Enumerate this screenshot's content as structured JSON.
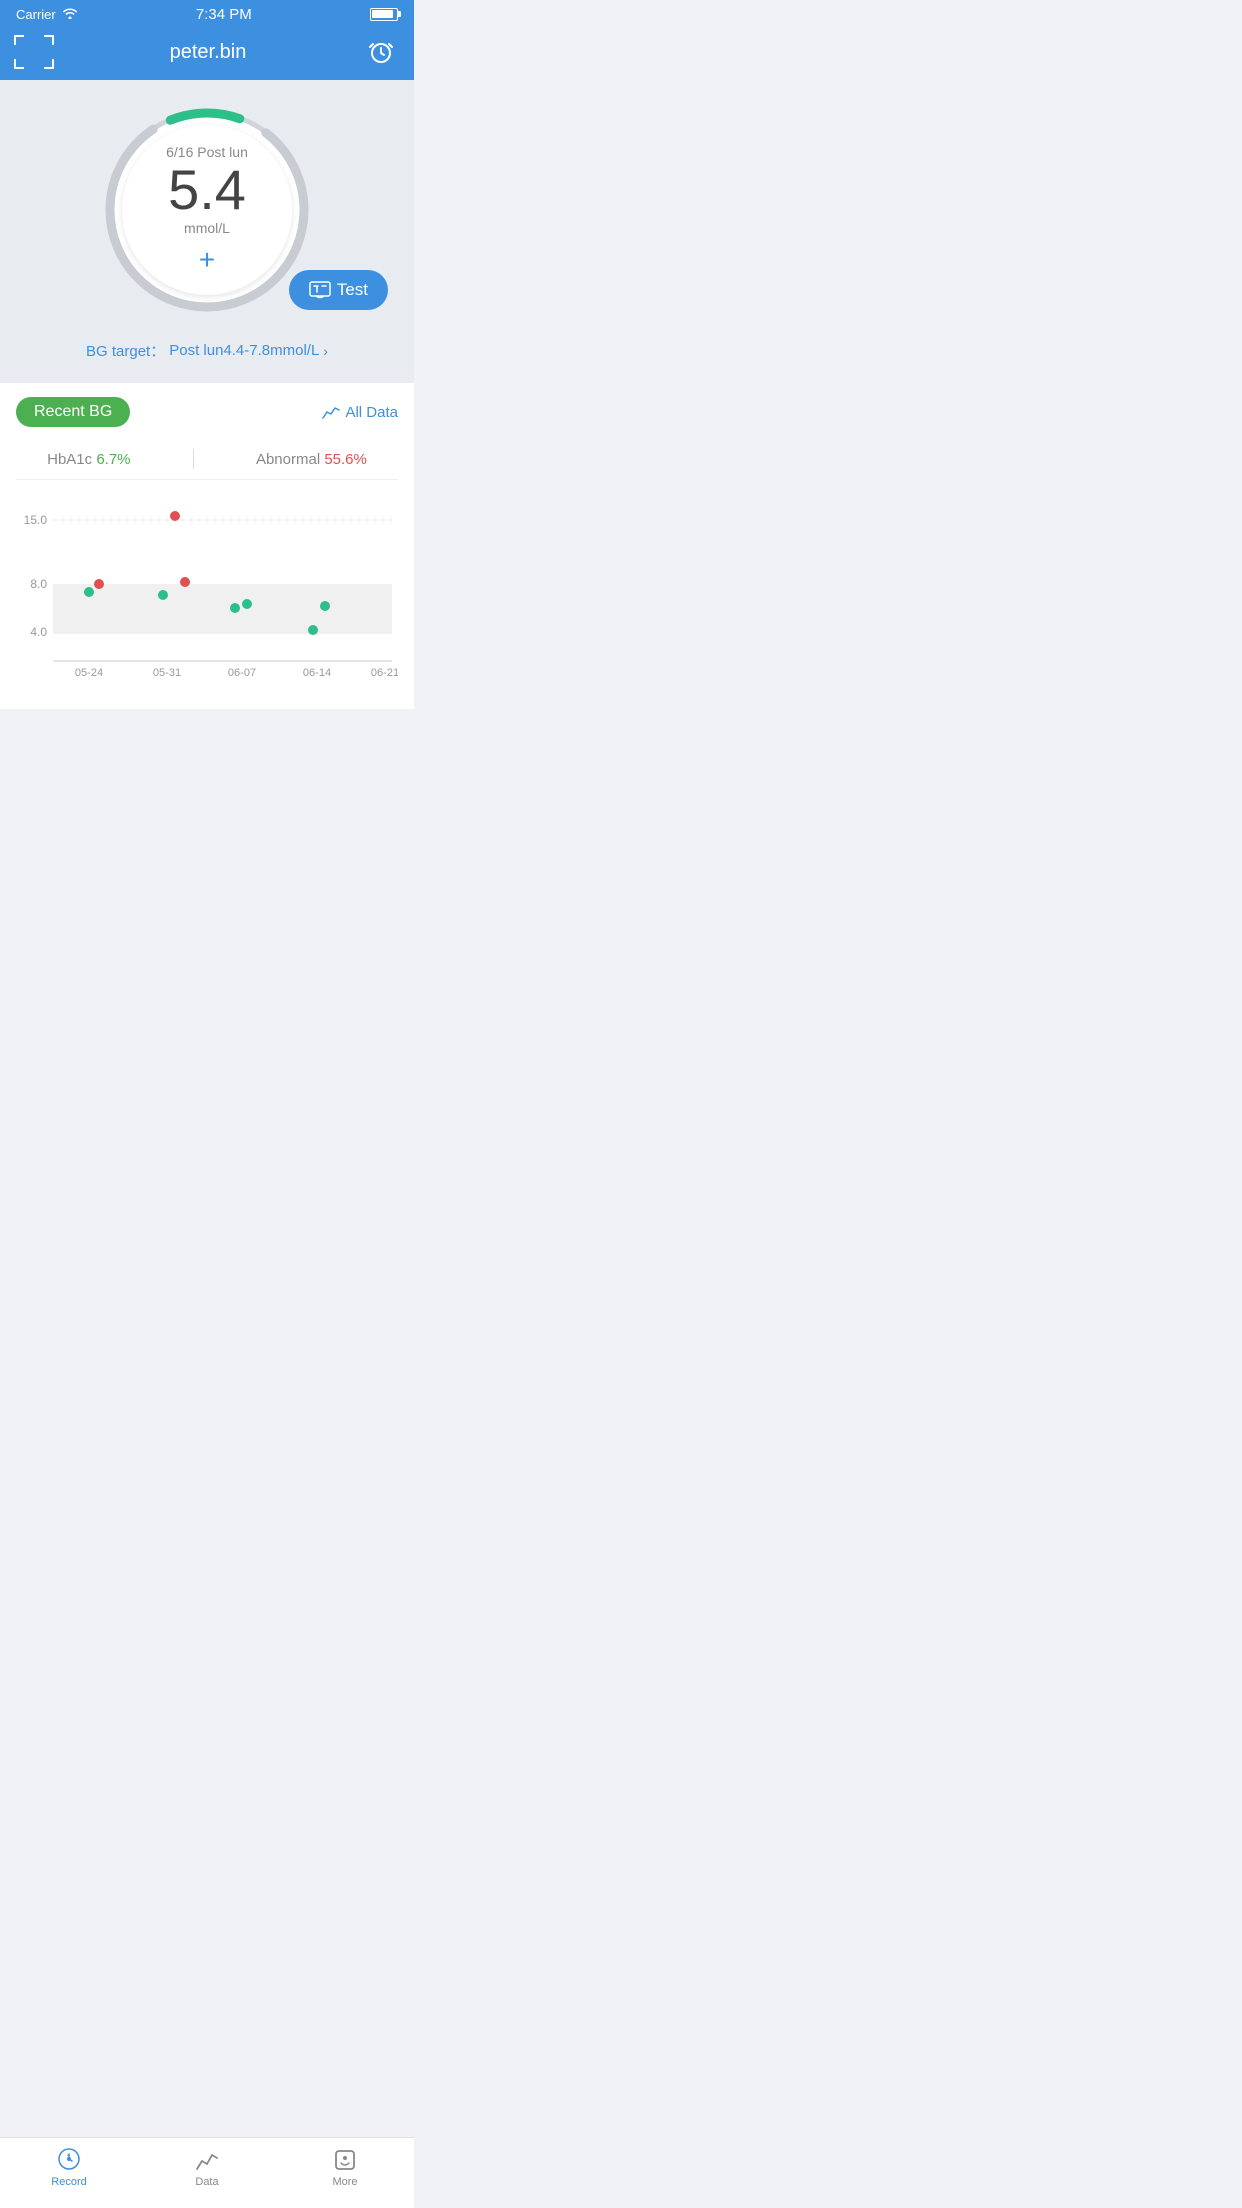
{
  "statusBar": {
    "carrier": "Carrier",
    "time": "7:34 PM"
  },
  "navBar": {
    "title": "peter.bin"
  },
  "bgGauge": {
    "date": "6/16",
    "mealTime": "Post lun",
    "value": "5.4",
    "unit": "mmol/L",
    "plusLabel": "+"
  },
  "testButton": {
    "label": "Test"
  },
  "bgTarget": {
    "text": "BG target：",
    "range": "Post lun4.4-7.8mmol/L"
  },
  "recentBG": {
    "sectionLabel": "Recent BG",
    "allDataLabel": "All Data",
    "hba1cLabel": "HbA1c",
    "hba1cValue": "6.7%",
    "abnormalLabel": "Abnormal",
    "abnormalValue": "55.6%"
  },
  "chart": {
    "yLabels": [
      "15.0",
      "8.0",
      "4.0"
    ],
    "xLabels": [
      "05-24",
      "05-31",
      "06-07",
      "06-14",
      "06-21"
    ],
    "bandMin": 4.0,
    "bandMax": 8.0,
    "yMin": 0,
    "yMax": 17,
    "points": [
      {
        "x": "05-24",
        "xOff": 0,
        "y": 7.5,
        "color": "green"
      },
      {
        "x": "05-24",
        "xOff": 8,
        "y": 8.4,
        "color": "red"
      },
      {
        "x": "05-31",
        "xOff": -6,
        "y": 7.2,
        "color": "green"
      },
      {
        "x": "05-31",
        "xOff": 6,
        "y": 15.8,
        "color": "red"
      },
      {
        "x": "05-31",
        "xOff": 16,
        "y": 8.6,
        "color": "red"
      },
      {
        "x": "06-07",
        "xOff": -6,
        "y": 5.9,
        "color": "green"
      },
      {
        "x": "06-07",
        "xOff": 8,
        "y": 6.3,
        "color": "green"
      },
      {
        "x": "06-14",
        "xOff": -4,
        "y": 4.4,
        "color": "green"
      },
      {
        "x": "06-14",
        "xOff": 12,
        "y": 6.2,
        "color": "green"
      }
    ]
  },
  "tabBar": {
    "tabs": [
      {
        "label": "Record",
        "active": true
      },
      {
        "label": "Data",
        "active": false
      },
      {
        "label": "More",
        "active": false
      }
    ]
  }
}
